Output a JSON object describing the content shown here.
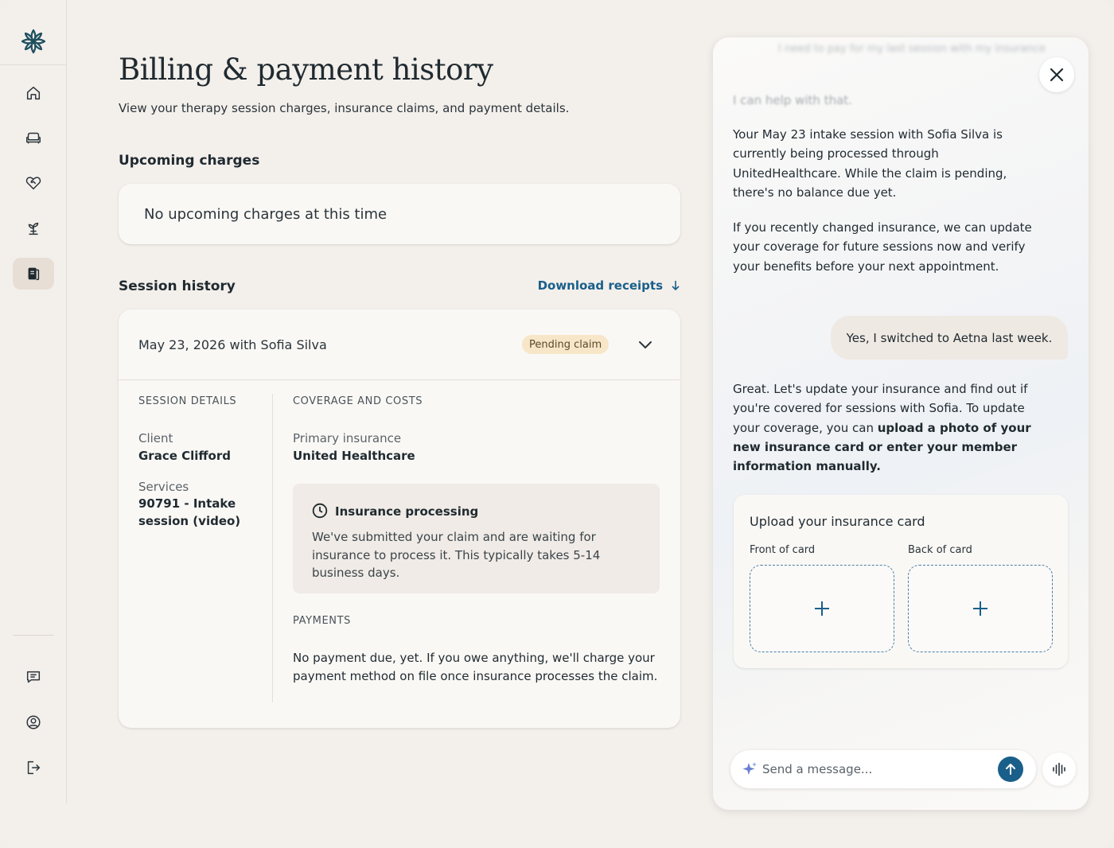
{
  "sidebar": {
    "logo": "lotus-logo",
    "nav": [
      {
        "icon": "home-icon"
      },
      {
        "icon": "couch-icon"
      },
      {
        "icon": "heart-handshake-icon"
      },
      {
        "icon": "plant-icon"
      },
      {
        "icon": "billing-book-icon",
        "active": true
      }
    ],
    "bottom": [
      {
        "icon": "messages-icon"
      },
      {
        "icon": "account-icon"
      },
      {
        "icon": "logout-icon"
      }
    ]
  },
  "main": {
    "title": "Billing & payment history",
    "subtitle": "View your therapy session charges, insurance claims, and payment details.",
    "upcoming": {
      "heading": "Upcoming charges",
      "empty_text": "No upcoming charges at this time"
    },
    "history": {
      "heading": "Session history",
      "download_label": "Download receipts",
      "session": {
        "date_line": "May 23, 2026 with Sofia Silva",
        "status": "Pending claim",
        "details_heading": "SESSION DETAILS",
        "client_label": "Client",
        "client_value": "Grace Clifford",
        "services_label": "Services",
        "services_value": "90791 - Intake session (video)",
        "coverage_heading": "COVERAGE AND COSTS",
        "insurance_label": "Primary insurance",
        "insurance_value": "United Healthcare",
        "processing_title": "Insurance processing",
        "processing_text": "We've submitted your claim and are waiting for insurance to process it. This typically takes 5-14 business days.",
        "payments_heading": "PAYMENTS",
        "payments_text": "No payment due, yet. If you owe anything, we'll charge your payment method on file once insurance processes the claim."
      }
    }
  },
  "chat": {
    "faded_top": "I need to pay for my last session with my insurance",
    "faded_msg": "I can help with that.",
    "messages": {
      "bot1": "Your May 23 intake session with Sofia Silva is currently being processed through UnitedHealthcare. While the claim is pending, there's no balance due yet.",
      "bot2": "If you recently changed insurance, we can update your coverage for future sessions now and verify your benefits before your next appointment.",
      "user1": "Yes, I switched to Aetna last week.",
      "bot3_plain": "Great. Let's update your insurance and find out if you're covered for sessions with Sofia. To update your coverage, you can ",
      "bot3_bold": "upload a photo of your new insurance card or enter your member information manually."
    },
    "upload": {
      "title": "Upload your insurance card",
      "front_label": "Front of card",
      "back_label": "Back of card"
    },
    "composer": {
      "placeholder": "Send a message..."
    },
    "accent_color": "#1a5f8a"
  }
}
